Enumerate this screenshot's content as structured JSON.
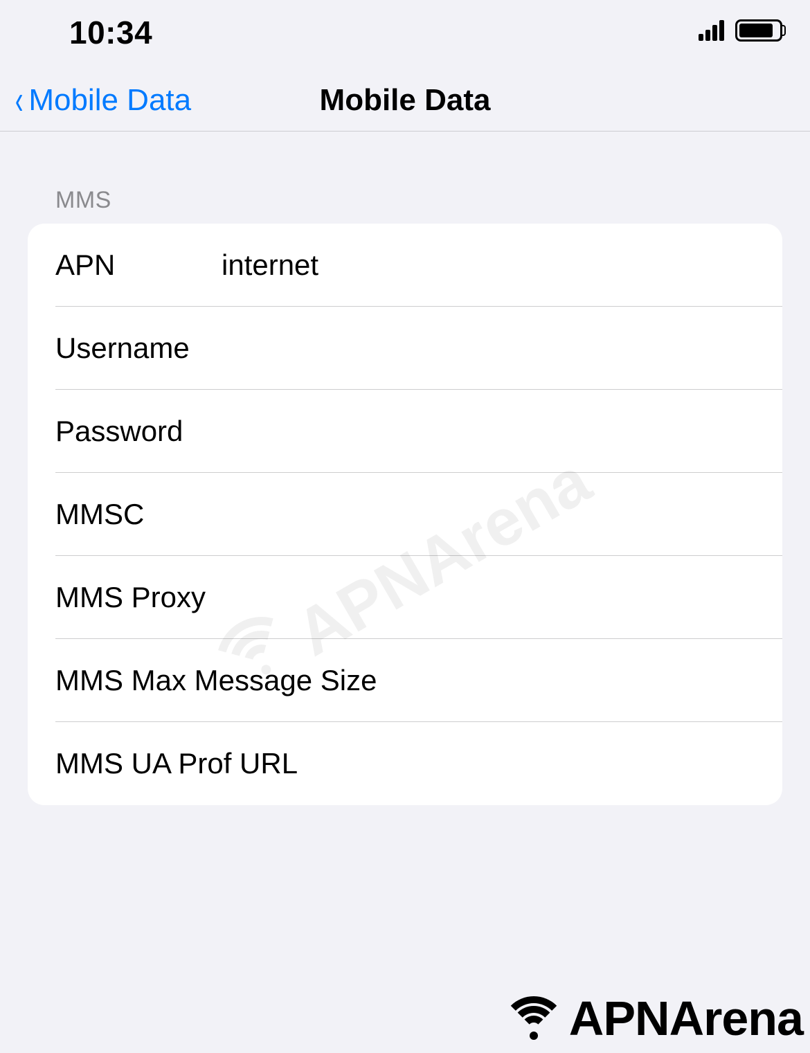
{
  "status": {
    "time": "10:34"
  },
  "nav": {
    "back_label": "Mobile Data",
    "title": "Mobile Data"
  },
  "section": {
    "header": "MMS",
    "rows": [
      {
        "label": "APN",
        "value": "internet"
      },
      {
        "label": "Username",
        "value": ""
      },
      {
        "label": "Password",
        "value": ""
      },
      {
        "label": "MMSC",
        "value": ""
      },
      {
        "label": "MMS Proxy",
        "value": ""
      },
      {
        "label": "MMS Max Message Size",
        "value": ""
      },
      {
        "label": "MMS UA Prof URL",
        "value": ""
      }
    ]
  },
  "watermark": {
    "text": "APNArena"
  },
  "footer": {
    "brand": "APNArena"
  }
}
